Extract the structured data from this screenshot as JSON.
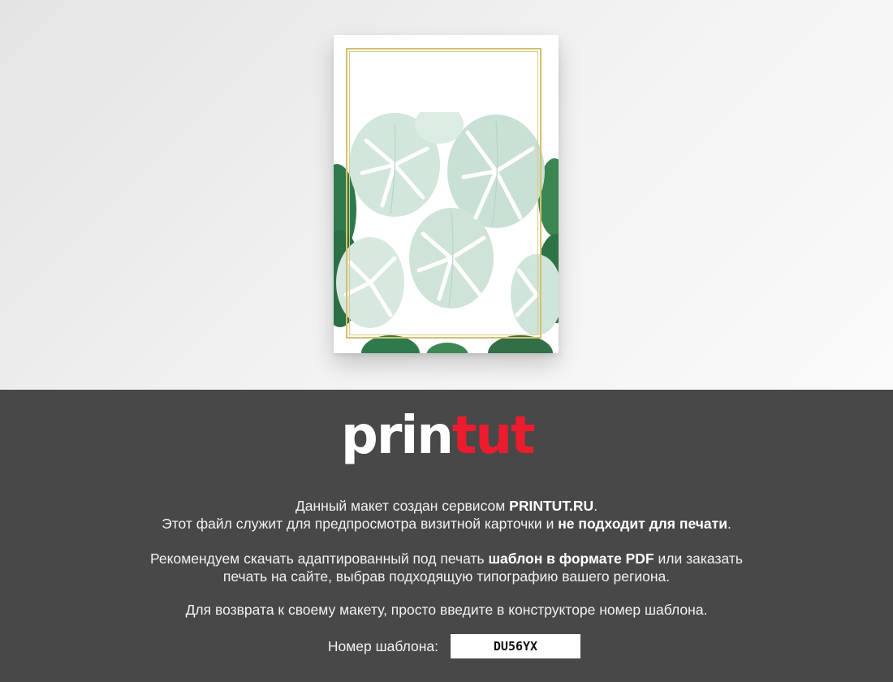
{
  "preview": {
    "card": {
      "frame_color": "#d5bf6f",
      "pattern": "monstera-leaves"
    }
  },
  "logo": {
    "part1": "prin",
    "part2": "tut",
    "part1_color": "#ffffff",
    "part2_color": "#ec1c2e"
  },
  "info": {
    "line1_pre": "Данный макет создан сервисом ",
    "line1_bold": "PRINTUT.RU",
    "line1_post": ".",
    "line2_pre": "Этот файл служит для предпросмотра визитной карточки и ",
    "line2_bold": "не подходит для печати",
    "line2_post": ".",
    "line3_pre": "Рекомендуем скачать адаптированный под печать ",
    "line3_bold": "шаблон в формате PDF",
    "line3_post": " или заказать",
    "line4": "печать на сайте, выбрав подходящую типографию вашего региона.",
    "line5": "Для возврата к своему макету, просто введите в конструкторе номер шаблона."
  },
  "template_code": {
    "label": "Номер шаблона:",
    "value": "DU56YX"
  }
}
